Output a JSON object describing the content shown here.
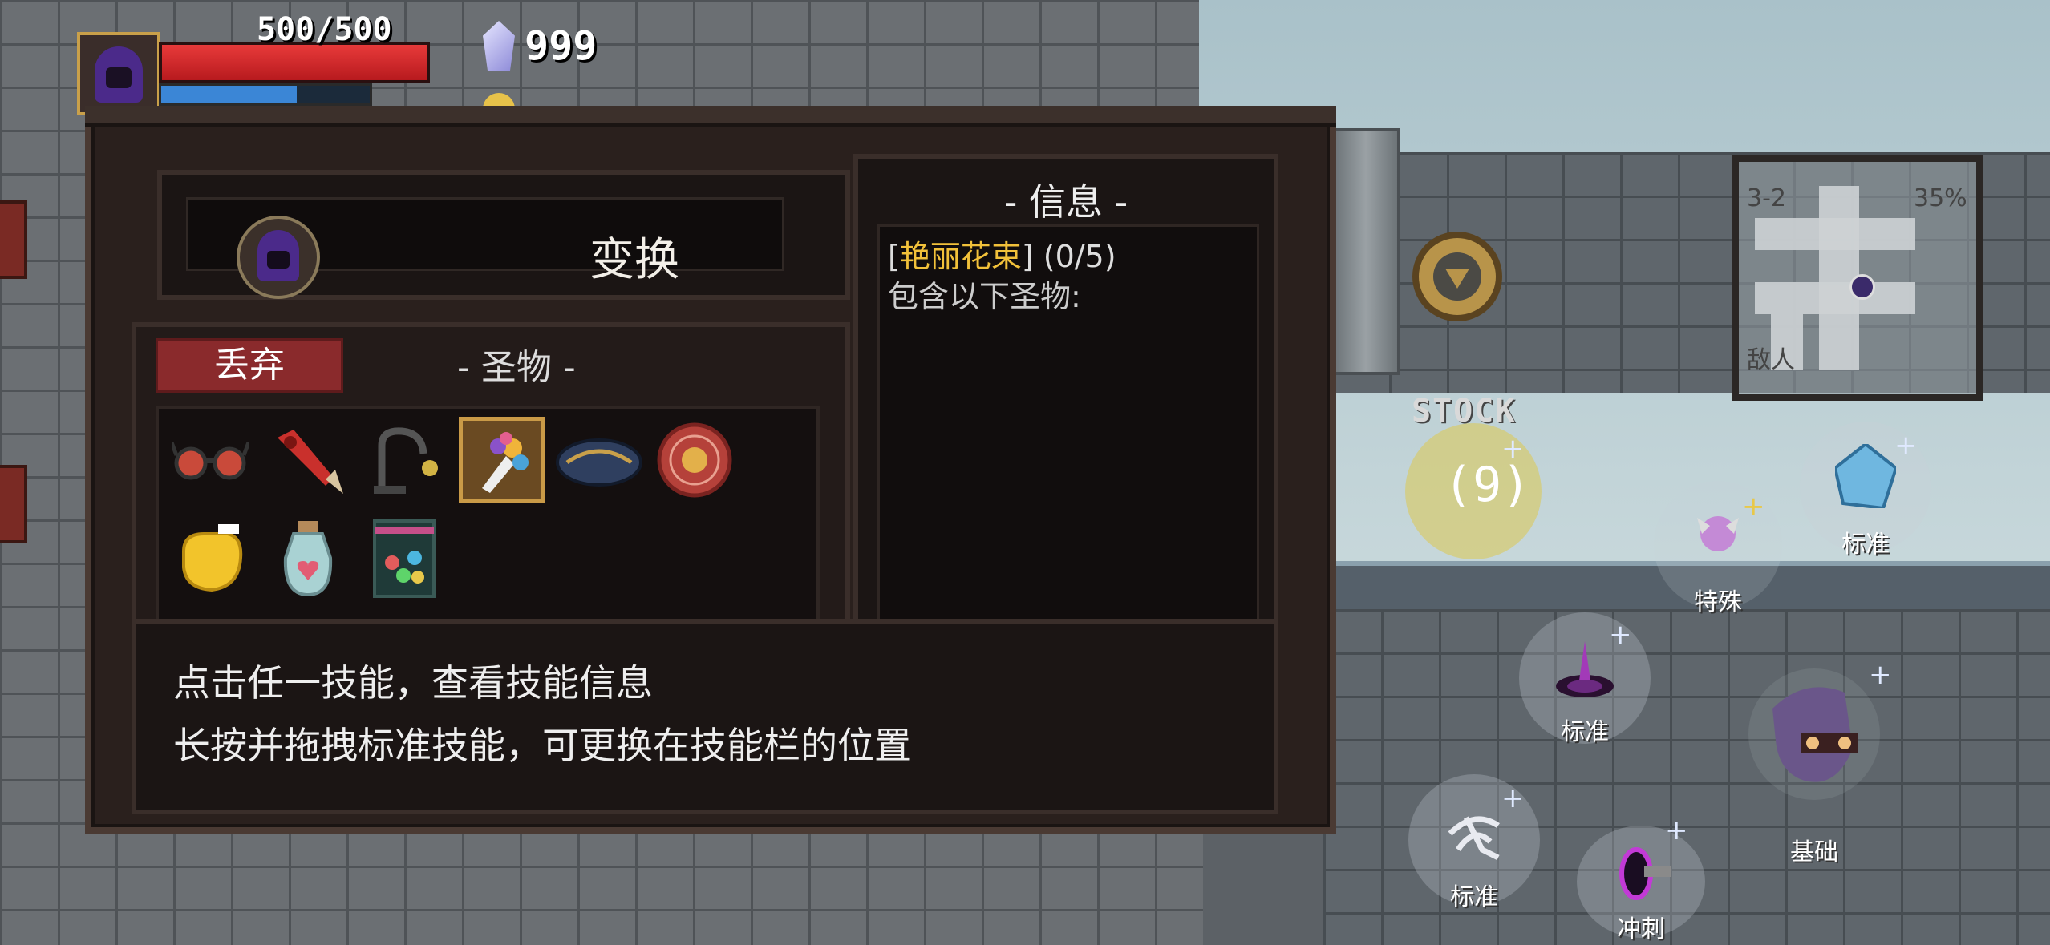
{
  "hud": {
    "hp_text": "500/500",
    "hp_fraction": 1.0,
    "mana_fraction": 0.65,
    "gem_count": "999",
    "gem_icon": "crystal-gem-icon",
    "coin_icon": "gold-coin-icon"
  },
  "dialog": {
    "skill_name": "变换",
    "relics": {
      "discard_label": "丢弃",
      "title": "- 圣物 -",
      "items": [
        {
          "name": "glasses-relic-icon"
        },
        {
          "name": "red-sword-relic-icon"
        },
        {
          "name": "dark-whip-relic-icon"
        },
        {
          "name": "flower-bouquet-relic-icon",
          "selected": true
        },
        {
          "name": "navy-hat-relic-icon"
        },
        {
          "name": "red-shield-relic-icon"
        },
        {
          "name": "golden-fist-relic-icon"
        },
        {
          "name": "heart-potion-relic-icon"
        },
        {
          "name": "gem-jar-relic-icon"
        }
      ]
    },
    "info": {
      "title": "- 信息 -",
      "bracket_open": "[",
      "item_name": "艳丽花束",
      "bracket_close": "]",
      "progress": " (0/5)",
      "contains": "包含以下圣物:"
    },
    "tips": {
      "line1": "点击任一技能，查看技能信息",
      "line2": "长按并拖拽标准技能，可更换在技能栏的位置"
    }
  },
  "minimap": {
    "stage": "3-2",
    "percent": "35%",
    "enemy_label": "敌人"
  },
  "skills": {
    "stock_label": "STOCK",
    "stock_count": "(9)",
    "standard_1": "标准",
    "special": "特殊",
    "standard_2": "标准",
    "basic": "基础",
    "standard_3": "标准",
    "dash": "冲刺"
  },
  "colors": {
    "accent_gold": "#f2c13a",
    "discard_red": "#8a2a2c",
    "hp_red": "#d42a2e",
    "mana_blue": "#3b86d6"
  }
}
